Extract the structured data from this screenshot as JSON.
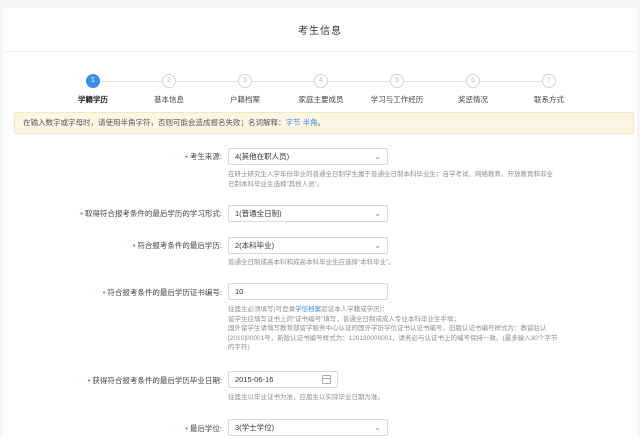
{
  "title": "考生信息",
  "steps": [
    {
      "num": "1",
      "label": "学籍学历"
    },
    {
      "num": "2",
      "label": "基本信息"
    },
    {
      "num": "3",
      "label": "户籍档案"
    },
    {
      "num": "4",
      "label": "家庭主要成员"
    },
    {
      "num": "5",
      "label": "学习与工作经历"
    },
    {
      "num": "6",
      "label": "奖惩情况"
    },
    {
      "num": "7",
      "label": "联系方式"
    }
  ],
  "notice": {
    "text": "在输入数字或字母时，请使用半角字符，否则可能会造成报名失败；名词解释：",
    "kw1": "字节",
    "kw2": "半角",
    "end": "。"
  },
  "fields": {
    "source": {
      "label": "考生来源:",
      "value": "4(其他在职人员)",
      "help": "在研士研究生入学年份毕业的普通全日制学生属于普通全日制本科毕业生；自学考试、网络教育、开放教育和非全日制本科毕业生选择“其他人员”。"
    },
    "study_form": {
      "label": "取得符合报考条件的最后学历的学习形式:",
      "value": "1(普通全日制)"
    },
    "degree": {
      "label": "符合报考条件的最后学历:",
      "value": "2(本科毕业)",
      "help": "普通全日制成高本科和成高本科毕业生应选择“本科毕业”。"
    },
    "cert": {
      "label": "符合报考条件的最后学历证书编号:",
      "value": "10",
      "help1": "往届生必须填写(可登录",
      "help_link": "学信档案",
      "help1b": "验证本人学籍或学历)：",
      "help2": "留学生应填写证书上的“证书编号”填写，普通全日制或成人专业本科毕业生手填；",
      "help3": "国外留学生请填写教育部留学服务中心认证的国外学历学位证书认证书编号，旧版认证书编号样式为：教留驻认[2010]00001号，新版认证书编号样式为：120180000001，请务必与认证书上的编号保持一致。(最多输入30个字节的字符)"
    },
    "grad_date": {
      "label": "获得符合报考条件的最后学历毕业日期:",
      "value": "2015-06-16",
      "help": "往届生以毕业证书为准，应届生以实际毕业日期为准。"
    },
    "final_degree": {
      "label": "最后学位:",
      "value": "3(学士学位)"
    }
  }
}
